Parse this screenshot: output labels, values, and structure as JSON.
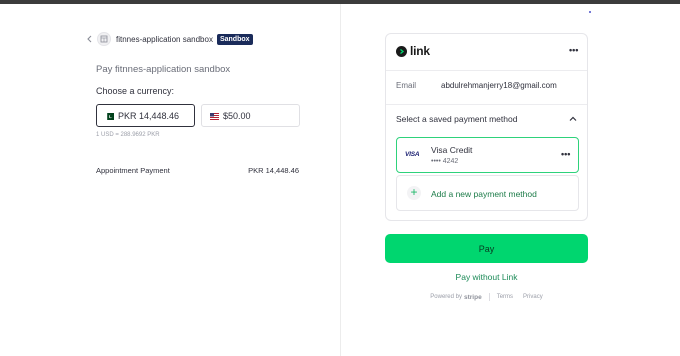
{
  "header": {
    "merchant_name": "fitnnes-application sandbox",
    "badge": "Sandbox"
  },
  "checkout": {
    "pay_title": "Pay fitnnes-application sandbox",
    "currency_label": "Choose a currency:",
    "currencies": [
      {
        "label": "PKR 14,448.46",
        "flag": "pakistan-flag",
        "selected": true
      },
      {
        "label": "$50.00",
        "flag": "us-flag",
        "selected": false
      }
    ],
    "rate_note": "1 USD = 288.9692 PKR",
    "line_item": {
      "name": "Appointment Payment",
      "amount": "PKR 14,448.46"
    }
  },
  "link": {
    "brand": "link",
    "email_label": "Email",
    "email_value": "abdulrehmanjerry18@gmail.com",
    "saved_label": "Select a saved payment method",
    "card": {
      "brand": "VISA",
      "name": "Visa Credit",
      "number": "•••• 4242"
    },
    "add_label": "Add a new payment method"
  },
  "actions": {
    "pay_label": "Pay",
    "pay_without_label": "Pay without Link"
  },
  "footer": {
    "powered_by": "Powered by",
    "stripe": "stripe",
    "terms": "Terms",
    "privacy": "Privacy"
  },
  "colors": {
    "accent": "#00d66f",
    "link_green": "#1b8a57",
    "badge_bg": "#1a2b5a"
  }
}
